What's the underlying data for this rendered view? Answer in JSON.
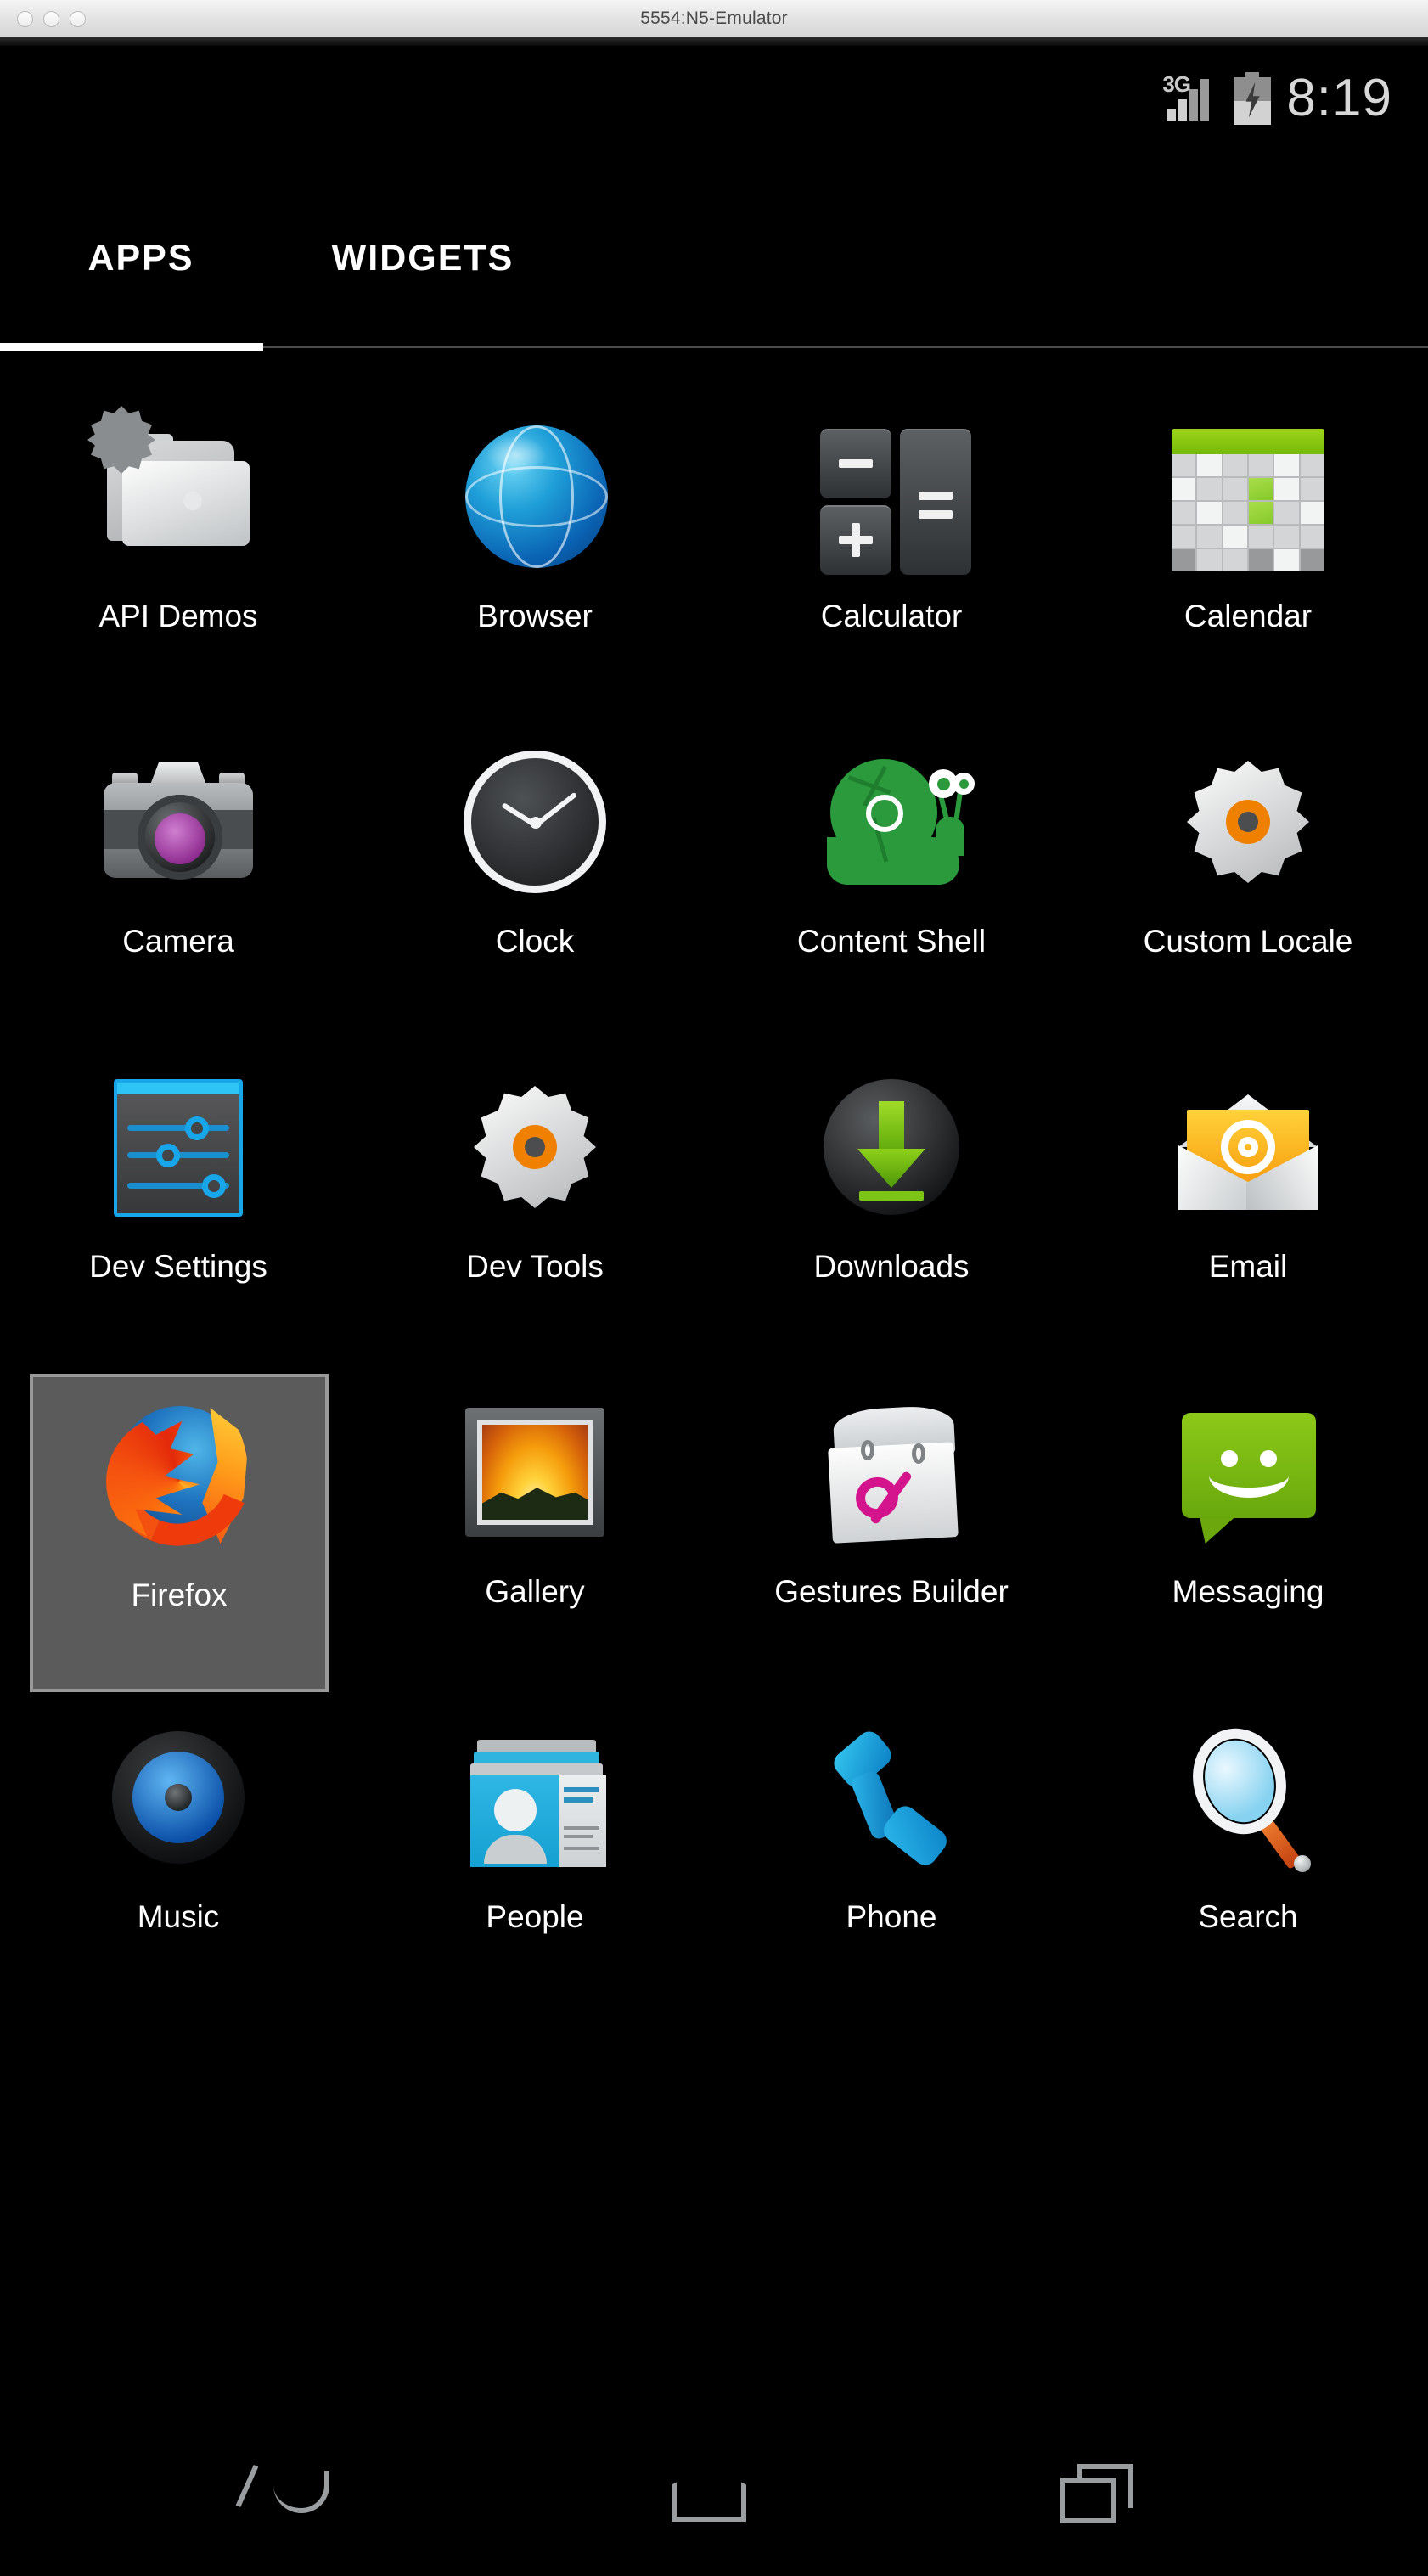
{
  "window": {
    "title": "5554:N5-Emulator",
    "traffic_lights": [
      "close",
      "minimize",
      "zoom"
    ]
  },
  "status_bar": {
    "network_type": "3G",
    "signal_bars_lit": 2,
    "signal_bars_total": 4,
    "battery_charging": true,
    "battery_level_pct": 50,
    "time": "8:19"
  },
  "tabs": {
    "items": [
      {
        "label": "APPS",
        "active": true
      },
      {
        "label": "WIDGETS",
        "active": false
      }
    ]
  },
  "apps": {
    "rows": [
      [
        {
          "label": "API Demos",
          "icon": "folder-gear-icon",
          "selected": false
        },
        {
          "label": "Browser",
          "icon": "blue-globe-icon",
          "selected": false
        },
        {
          "label": "Calculator",
          "icon": "calculator-keys-icon",
          "selected": false
        },
        {
          "label": "Calendar",
          "icon": "calendar-grid-icon",
          "selected": false
        }
      ],
      [
        {
          "label": "Camera",
          "icon": "camera-icon",
          "selected": false
        },
        {
          "label": "Clock",
          "icon": "analog-clock-icon",
          "selected": false
        },
        {
          "label": "Content Shell",
          "icon": "green-snail-icon",
          "selected": false
        },
        {
          "label": "Custom Locale",
          "icon": "gear-orange-icon",
          "selected": false
        }
      ],
      [
        {
          "label": "Dev Settings",
          "icon": "sliders-panel-icon",
          "selected": false
        },
        {
          "label": "Dev Tools",
          "icon": "gear-orange-icon",
          "selected": false
        },
        {
          "label": "Downloads",
          "icon": "download-arrow-icon",
          "selected": false
        },
        {
          "label": "Email",
          "icon": "envelope-at-icon",
          "selected": false
        }
      ],
      [
        {
          "label": "Firefox",
          "icon": "firefox-icon",
          "selected": true
        },
        {
          "label": "Gallery",
          "icon": "picture-frame-icon",
          "selected": false
        },
        {
          "label": "Gestures Builder",
          "icon": "notepad-gesture-icon",
          "selected": false
        },
        {
          "label": "Messaging",
          "icon": "green-smiley-bubble-icon",
          "selected": false
        }
      ],
      [
        {
          "label": "Music",
          "icon": "speaker-icon",
          "selected": false
        },
        {
          "label": "People",
          "icon": "contact-card-icon",
          "selected": false
        },
        {
          "label": "Phone",
          "icon": "blue-handset-icon",
          "selected": false
        },
        {
          "label": "Search",
          "icon": "magnifier-icon",
          "selected": false
        }
      ]
    ]
  },
  "nav_bar": {
    "buttons": [
      {
        "name": "back",
        "icon": "back-arrow-icon"
      },
      {
        "name": "home",
        "icon": "home-pentagon-icon"
      },
      {
        "name": "recents",
        "icon": "recents-squares-icon"
      }
    ]
  },
  "colors": {
    "screen_background": "#000000",
    "accent_selected": "#5b5b5b",
    "tab_active_underline": "#ffffff",
    "label_text": "#ffffff",
    "nav_icon": "#9a9d9f",
    "status_text": "#d8d8d8"
  }
}
